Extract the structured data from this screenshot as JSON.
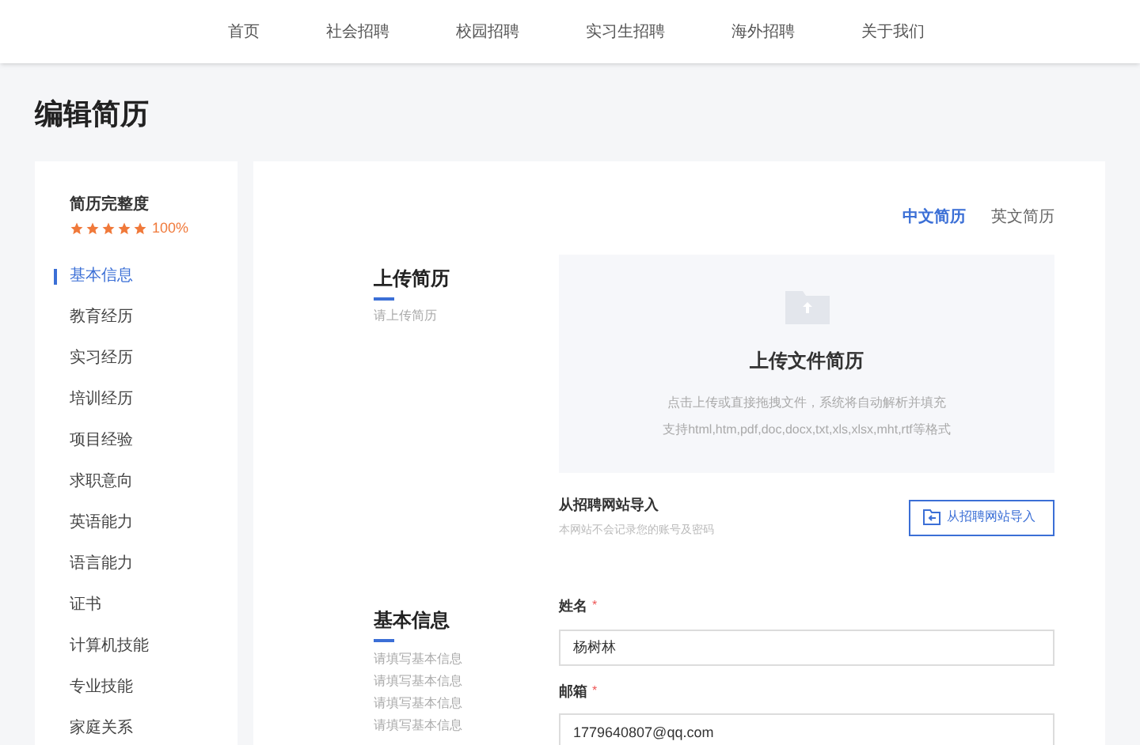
{
  "nav": [
    {
      "label": "首页"
    },
    {
      "label": "社会招聘"
    },
    {
      "label": "校园招聘"
    },
    {
      "label": "实习生招聘"
    },
    {
      "label": "海外招聘"
    },
    {
      "label": "关于我们"
    }
  ],
  "page_title": "编辑简历",
  "sidebar": {
    "completeness_label": "简历完整度",
    "stars": 5,
    "percent": "100%",
    "items": [
      {
        "label": "基本信息",
        "selected": true
      },
      {
        "label": "教育经历",
        "selected": false
      },
      {
        "label": "实习经历",
        "selected": false
      },
      {
        "label": "培训经历",
        "selected": false
      },
      {
        "label": "项目经验",
        "selected": false
      },
      {
        "label": "求职意向",
        "selected": false
      },
      {
        "label": "英语能力",
        "selected": false
      },
      {
        "label": "语言能力",
        "selected": false
      },
      {
        "label": "证书",
        "selected": false
      },
      {
        "label": "计算机技能",
        "selected": false
      },
      {
        "label": "专业技能",
        "selected": false
      },
      {
        "label": "家庭关系",
        "selected": false
      }
    ]
  },
  "language_tabs": [
    {
      "label": "中文简历",
      "selected": true
    },
    {
      "label": "英文简历",
      "selected": false
    }
  ],
  "upload_section": {
    "title": "上传简历",
    "description": "请上传简历",
    "box_title": "上传文件简历",
    "box_hint_1": "点击上传或直接拖拽文件，系统将自动解析并填充",
    "box_hint_2": "支持html,htm,pdf,doc,docx,txt,xls,xlsx,mht,rtf等格式",
    "import_title": "从招聘网站导入",
    "import_note": "本网站不会记录您的账号及密码",
    "import_button": "从招聘网站导入"
  },
  "basic_section": {
    "title": "基本信息",
    "description": "请填写基本信息请填写基本信息请填写基本信息请填写基本信息",
    "fields": [
      {
        "label": "姓名",
        "required_mark": "*",
        "value": "杨树林"
      },
      {
        "label": "邮箱",
        "required_mark": "*",
        "value": "1779640807@qq.com"
      }
    ]
  }
}
